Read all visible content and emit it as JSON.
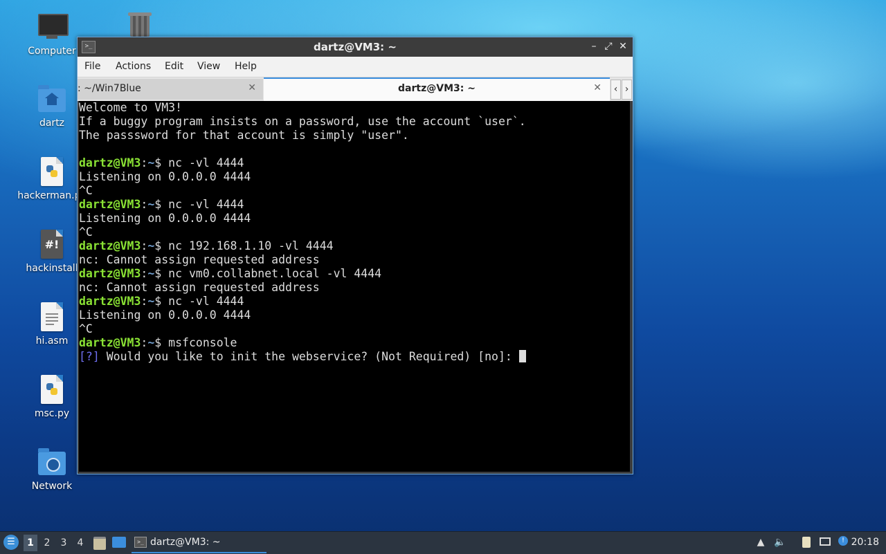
{
  "desktop": {
    "icons": [
      {
        "label": "Computer"
      },
      {
        "label": "dartz"
      },
      {
        "label": "hackerman.py"
      },
      {
        "label": "hackinstall"
      },
      {
        "label": "hi.asm"
      },
      {
        "label": "msc.py"
      },
      {
        "label": "Network"
      }
    ],
    "hackinstall_glyph": "#!"
  },
  "window": {
    "title": "dartz@VM3: ~",
    "title_icon": ">_",
    "controls": {
      "minimize": "–",
      "maximize": "⤢",
      "close": "✕"
    },
    "menu": [
      "File",
      "Actions",
      "Edit",
      "View",
      "Help"
    ],
    "tabs": [
      {
        "label": ": ~/Win7Blue",
        "active": false
      },
      {
        "label": "dartz@VM3: ~",
        "active": true
      }
    ],
    "tab_close": "✕",
    "tab_nav": {
      "left": "‹",
      "right": "›"
    }
  },
  "terminal": {
    "prompt": {
      "user": "dartz@VM3",
      "sep": ":",
      "path": "~",
      "sigil": "$ "
    },
    "lines": [
      {
        "type": "text",
        "text": "Welcome to VM3!"
      },
      {
        "type": "text",
        "text": "If a buggy program insists on a password, use the account `user`."
      },
      {
        "type": "text",
        "text": "The passsword for that account is simply \"user\"."
      },
      {
        "type": "text",
        "text": ""
      },
      {
        "type": "cmd",
        "text": "nc -vl 4444"
      },
      {
        "type": "text",
        "text": "Listening on 0.0.0.0 4444"
      },
      {
        "type": "text",
        "text": "^C"
      },
      {
        "type": "cmd",
        "text": "nc -vl 4444"
      },
      {
        "type": "text",
        "text": "Listening on 0.0.0.0 4444"
      },
      {
        "type": "text",
        "text": "^C"
      },
      {
        "type": "cmd",
        "text": "nc 192.168.1.10 -vl 4444"
      },
      {
        "type": "text",
        "text": "nc: Cannot assign requested address"
      },
      {
        "type": "cmd",
        "text": "nc vm0.collabnet.local -vl 4444"
      },
      {
        "type": "text",
        "text": "nc: Cannot assign requested address"
      },
      {
        "type": "cmd",
        "text": "nc -vl 4444"
      },
      {
        "type": "text",
        "text": "Listening on 0.0.0.0 4444"
      },
      {
        "type": "text",
        "text": "^C"
      },
      {
        "type": "cmd",
        "text": "msfconsole"
      }
    ],
    "question": {
      "tag": "[?]",
      "text": " Would you like to init the webservice? (Not Required) [no]: "
    },
    "colors": {
      "user": "#8ae234",
      "path": "#729fcf",
      "tag": "#6f6ff0"
    }
  },
  "taskbar": {
    "start_icon": "menu-icon",
    "workspaces": [
      "1",
      "2",
      "3",
      "4"
    ],
    "active_workspace": "1",
    "task_label": "dartz@VM3: ~",
    "clock": "20:18"
  }
}
